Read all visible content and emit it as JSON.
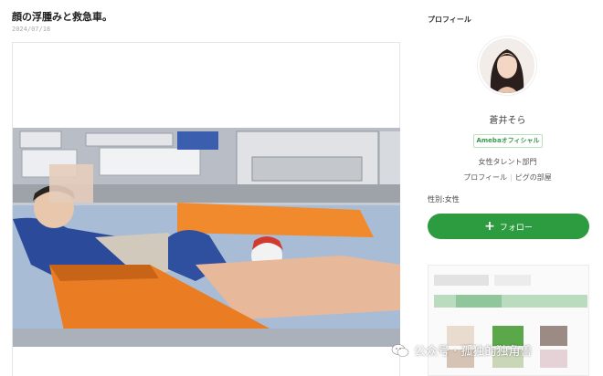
{
  "post": {
    "title": "顔の浮腫みと救急車。",
    "date": "2024/07/18"
  },
  "sidebar": {
    "heading": "プロフィール",
    "name": "蒼井そら",
    "badge": "Amebaオフィシャル",
    "category": "女性タレント部門",
    "links": [
      "プロフィール",
      "ピグの部屋"
    ],
    "gender": "性別:女性",
    "follow_label": "フォロー"
  },
  "watermark": {
    "text": "公众号 · 孤独的独角兽"
  },
  "colors": {
    "follow_green": "#2d9b3f",
    "badge_green": "#3a9a4e"
  }
}
